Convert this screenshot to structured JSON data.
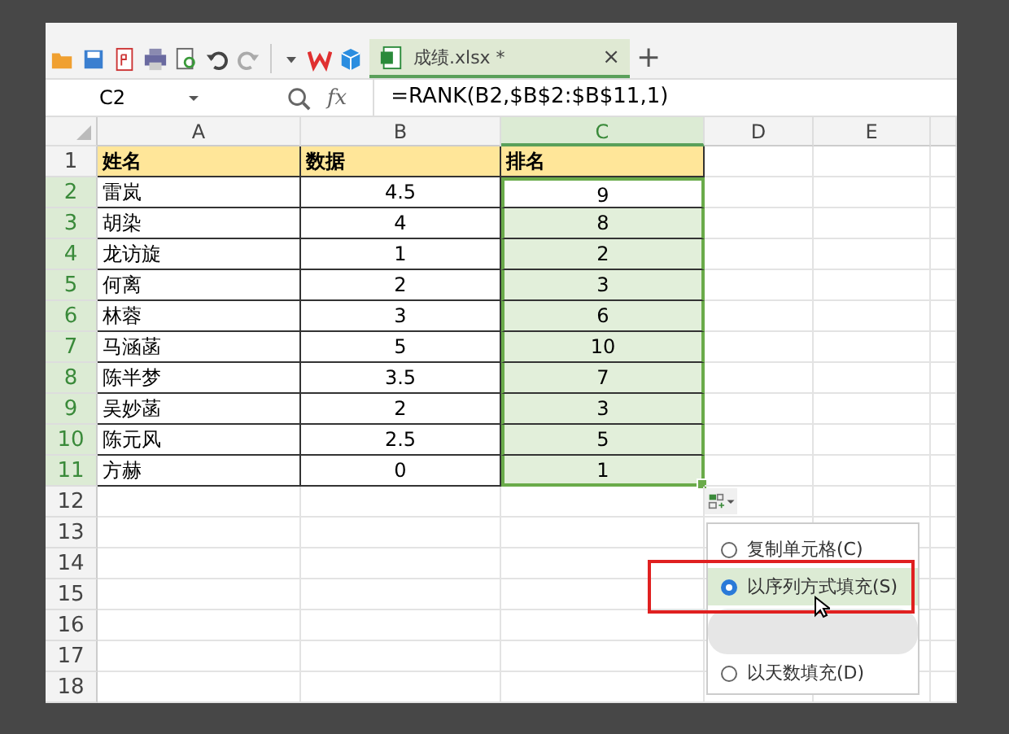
{
  "toolbar": {
    "tab": {
      "label": "成绩.xlsx *",
      "close": "×",
      "selected": true
    },
    "new_tab": "+"
  },
  "formula_bar": {
    "name_box": "C2",
    "fx": "fx",
    "formula": "=RANK(B2,$B$2:$B$11,1)"
  },
  "columns": [
    {
      "label": "A",
      "selected": false
    },
    {
      "label": "B",
      "selected": false
    },
    {
      "label": "C",
      "selected": true
    },
    {
      "label": "D",
      "selected": false
    },
    {
      "label": "E",
      "selected": false
    }
  ],
  "rows": [
    {
      "number": "1",
      "selected": false,
      "cells": [
        "姓名",
        "数据",
        "排名"
      ]
    },
    {
      "number": "2",
      "selected": true,
      "cells": [
        "雷岚",
        "4.5",
        "9"
      ]
    },
    {
      "number": "3",
      "selected": true,
      "cells": [
        "胡染",
        "4",
        "8"
      ]
    },
    {
      "number": "4",
      "selected": true,
      "cells": [
        "龙访旋",
        "1",
        "2"
      ]
    },
    {
      "number": "5",
      "selected": true,
      "cells": [
        "何离",
        "2",
        "3"
      ]
    },
    {
      "number": "6",
      "selected": true,
      "cells": [
        "林蓉",
        "3",
        "6"
      ]
    },
    {
      "number": "7",
      "selected": true,
      "cells": [
        "马涵菡",
        "5",
        "10"
      ]
    },
    {
      "number": "8",
      "selected": true,
      "cells": [
        "陈半梦",
        "3.5",
        "7"
      ]
    },
    {
      "number": "9",
      "selected": true,
      "cells": [
        "吴妙菡",
        "2",
        "3"
      ]
    },
    {
      "number": "10",
      "selected": true,
      "cells": [
        "陈元风",
        "2.5",
        "5"
      ]
    },
    {
      "number": "11",
      "selected": true,
      "cells": [
        "方赫",
        "0",
        "1"
      ]
    },
    {
      "number": "12",
      "selected": false,
      "cells": []
    },
    {
      "number": "13",
      "selected": false,
      "cells": []
    },
    {
      "number": "14",
      "selected": false,
      "cells": []
    },
    {
      "number": "15",
      "selected": false,
      "cells": []
    },
    {
      "number": "16",
      "selected": false,
      "cells": []
    },
    {
      "number": "17",
      "selected": false,
      "cells": []
    },
    {
      "number": "18",
      "selected": false,
      "cells": []
    }
  ],
  "fill_menu": {
    "items": [
      {
        "label": "复制单元格(C)",
        "selected": false
      },
      {
        "label": "以序列方式填充(S)",
        "selected": true
      },
      {
        "label": "以天数填充(D)",
        "selected": false
      }
    ]
  }
}
